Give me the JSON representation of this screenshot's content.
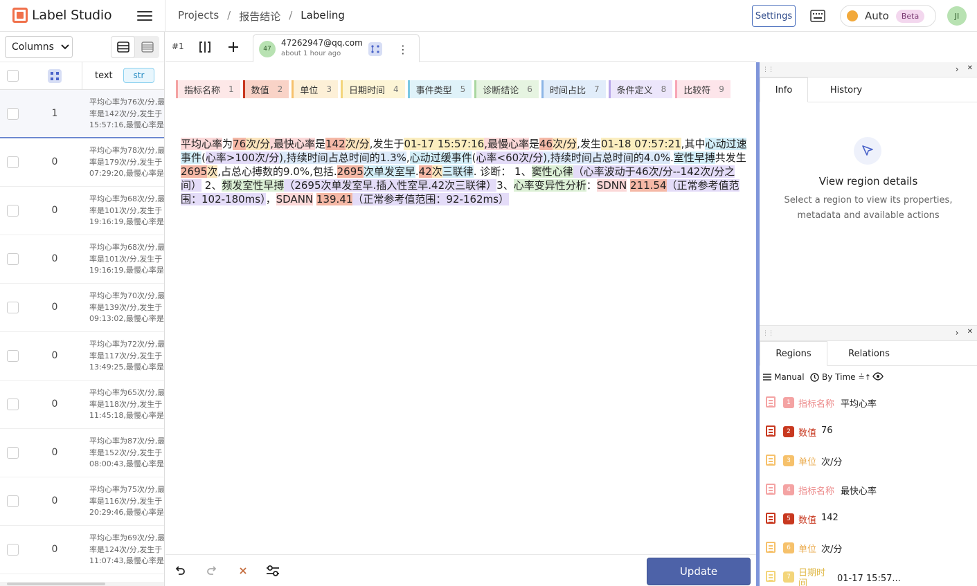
{
  "app": {
    "name": "Label Studio"
  },
  "breadcrumb": {
    "projects": "Projects",
    "sep1": "/",
    "project": "报告结论",
    "sep2": "/",
    "current": "Labeling"
  },
  "header": {
    "settings_label": "Settings",
    "auto_label": "Auto",
    "beta_label": "Beta",
    "user_initials": "JI"
  },
  "left_panel": {
    "columns_label": "Columns",
    "text_column": "text",
    "type_badge": "str",
    "rows": [
      {
        "count": "1",
        "lines": [
          "平均心率为76次/分,最",
          "率是142次/分,发生于",
          "15:57:16,最慢心率是"
        ]
      },
      {
        "count": "0",
        "lines": [
          "平均心率为78次/分,最",
          "率是179次/分,发生于",
          "07:29:20,最慢心率是"
        ]
      },
      {
        "count": "0",
        "lines": [
          "平均心率为68次/分,最",
          "率是101次/分,发生于",
          "19:16:19,最慢心率是"
        ]
      },
      {
        "count": "0",
        "lines": [
          "平均心率为68次/分,最",
          "率是101次/分,发生于",
          "19:16:19,最慢心率是"
        ]
      },
      {
        "count": "0",
        "lines": [
          "平均心率为70次/分,最",
          "率是139次/分,发生于",
          "09:13:02,最慢心率是"
        ]
      },
      {
        "count": "0",
        "lines": [
          "平均心率为72次/分,最",
          "率是117次/分,发生于",
          "13:49:25,最慢心率是"
        ]
      },
      {
        "count": "0",
        "lines": [
          "平均心率为65次/分,最",
          "率是118次/分,发生于",
          "11:45:18,最慢心率是"
        ]
      },
      {
        "count": "0",
        "lines": [
          "平均心率为87次/分,最",
          "率是152次/分,发生于",
          "08:00:43,最慢心率是"
        ]
      },
      {
        "count": "0",
        "lines": [
          "平均心率为75次/分,最",
          "率是116次/分,发生于",
          "20:29:46,最慢心率是"
        ]
      },
      {
        "count": "0",
        "lines": [
          "平均心率为69次/分,最",
          "率是124次/分,发生于",
          "11:07:43,最慢心率是"
        ]
      }
    ]
  },
  "tabbar": {
    "task_number": "#1",
    "annotator_initials": "47",
    "annotator_email": "47262947@qq.com",
    "annotation_time": "about 1 hour ago"
  },
  "labels": [
    {
      "name": "指标名称",
      "hotkey": "1",
      "color": "#f4a3a3",
      "bg": "#fde8e8"
    },
    {
      "name": "数值",
      "hotkey": "2",
      "color": "#c8381f",
      "bg": "#f9d3c7"
    },
    {
      "name": "单位",
      "hotkey": "3",
      "color": "#f6c16b",
      "bg": "#fdf0d7"
    },
    {
      "name": "日期时间",
      "hotkey": "4",
      "color": "#f3d57a",
      "bg": "#fdf5d6"
    },
    {
      "name": "事件类型",
      "hotkey": "5",
      "color": "#7ac8e3",
      "bg": "#dff2f9"
    },
    {
      "name": "诊断结论",
      "hotkey": "6",
      "color": "#a9d7a0",
      "bg": "#e6f4e1"
    },
    {
      "name": "时间占比",
      "hotkey": "7",
      "color": "#8cb5e6",
      "bg": "#e1edfa"
    },
    {
      "name": "条件定义",
      "hotkey": "8",
      "color": "#b9a7ea",
      "bg": "#ece6fb"
    },
    {
      "name": "比较符",
      "hotkey": "9",
      "color": "#f7a6b6",
      "bg": "#fde5ea"
    }
  ],
  "document": {
    "segments": [
      {
        "t": "平均心率",
        "c": "#fbd8d8"
      },
      {
        "t": "为"
      },
      {
        "t": "76",
        "c": "#f5b8a6"
      },
      {
        "t": "次/分",
        "c": "#fce5bd"
      },
      {
        "t": ",最快心率",
        "c": "#fbd8d8"
      },
      {
        "t": "是"
      },
      {
        "t": "142",
        "c": "#f5b8a6"
      },
      {
        "t": "次/分",
        "c": "#fce5bd"
      },
      {
        "t": ",发生于"
      },
      {
        "t": "01-17 15:57:16",
        "c": "#fbeebf"
      },
      {
        "t": ",最慢心率",
        "c": "#fbd8d8"
      },
      {
        "t": "是"
      },
      {
        "t": "46",
        "c": "#f5b8a6"
      },
      {
        "t": "次/分",
        "c": "#fce5bd"
      },
      {
        "t": ",发生"
      },
      {
        "t": "01-18 07:57:21",
        "c": "#fbeebf"
      },
      {
        "t": ",其中"
      },
      {
        "t": "心动过速事件",
        "c": "#d2eef8"
      },
      {
        "t": "("
      },
      {
        "t": "心率>100次/分",
        "c": "#e4dcf8"
      },
      {
        "t": "),持续时间占总时间的1.3%",
        "c": "#dceafa"
      },
      {
        "t": ","
      },
      {
        "t": "心动过缓事件",
        "c": "#d2eef8"
      },
      {
        "t": "("
      },
      {
        "t": "心率<60次/分",
        "c": "#e4dcf8"
      },
      {
        "t": "),持续时间占总时间的4.0%",
        "c": "#dceafa"
      },
      {
        "t": "."
      },
      {
        "t": "室性早搏",
        "c": "#d2eef8"
      },
      {
        "t": "共发生"
      },
      {
        "t": "2695",
        "c": "#f5b8a6"
      },
      {
        "t": "次",
        "c": "#fce5bd"
      },
      {
        "t": ",占总心搏数的9.0%,包括."
      },
      {
        "t": "2695",
        "c": "#f5b8a6"
      },
      {
        "t": "次单发室早",
        "c": "#d2eef8"
      },
      {
        "t": "."
      },
      {
        "t": "42",
        "c": "#f5b8a6"
      },
      {
        "t": "次",
        "c": "#fce5bd"
      },
      {
        "t": "三联律",
        "c": "#d2eef8"
      },
      {
        "t": ". 诊断： 1、"
      },
      {
        "t": "窦性心律",
        "c": "#dcf0d6"
      },
      {
        "t": "（心率波动于46次/分--142次/分之间）",
        "c": "#e4dcf8"
      },
      {
        "t": " 2、"
      },
      {
        "t": "频发室性早搏",
        "c": "#dcf0d6"
      },
      {
        "t": "（2695次单发室早.插入性室早.42次三联律）",
        "c": "#e4dcf8"
      },
      {
        "t": "3、"
      },
      {
        "t": "心率变异性分析",
        "c": "#dcf0d6"
      },
      {
        "t": "："
      },
      {
        "t": "SDNN",
        "c": "#fbd8d8"
      },
      {
        "t": " "
      },
      {
        "t": "211.54",
        "c": "#f5b8a6"
      },
      {
        "t": "（正常参考值范围：102-180ms）",
        "c": "#e4dcf8"
      },
      {
        "t": "，"
      },
      {
        "t": "SDANN",
        "c": "#fbd8d8"
      },
      {
        "t": " "
      },
      {
        "t": "139.41",
        "c": "#f5b8a6"
      },
      {
        "t": "（正常参考值范围：92-162ms）",
        "c": "#e4dcf8"
      }
    ]
  },
  "bottom": {
    "update_label": "Update"
  },
  "info_panel": {
    "tab_info": "Info",
    "tab_history": "History",
    "title": "View region details",
    "subtitle": "Select a region to view its properties, metadata and available actions"
  },
  "regions_panel": {
    "tab_regions": "Regions",
    "tab_relations": "Relations",
    "manual_label": "Manual",
    "sort_label": "By Time",
    "items": [
      {
        "num": "1",
        "label": "指标名称",
        "text": "平均心率",
        "color": "#f4a3a3",
        "label_color": "#ec8a8a"
      },
      {
        "num": "2",
        "label": "数值",
        "text": "76",
        "color": "#c8381f",
        "label_color": "#c8381f"
      },
      {
        "num": "3",
        "label": "单位",
        "text": "次/分",
        "color": "#f6c16b",
        "label_color": "#eaa94a"
      },
      {
        "num": "4",
        "label": "指标名称",
        "text": "最快心率",
        "color": "#f4a3a3",
        "label_color": "#ec8a8a"
      },
      {
        "num": "5",
        "label": "数值",
        "text": "142",
        "color": "#c8381f",
        "label_color": "#c8381f"
      },
      {
        "num": "6",
        "label": "单位",
        "text": "次/分",
        "color": "#f6c16b",
        "label_color": "#eaa94a"
      },
      {
        "num": "7",
        "label": "日期时间",
        "text": "01-17 15:57...",
        "color": "#f3d57a",
        "label_color": "#e0b949"
      }
    ]
  }
}
